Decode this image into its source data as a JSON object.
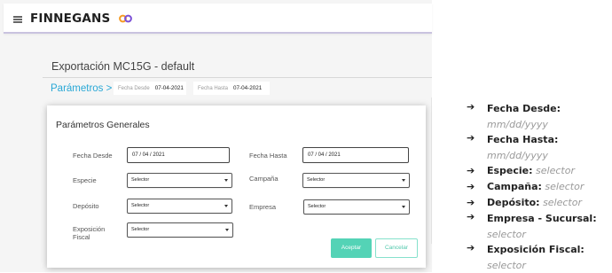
{
  "brand": {
    "name": "FINNEGANS"
  },
  "page": {
    "title": "Exportación MC15G - default"
  },
  "breadcrumb": {
    "link": "Parámetros >",
    "chips": [
      {
        "label": "Fecha Desde",
        "value": "07-04-2021"
      },
      {
        "label": "Fecha Hasta",
        "value": "07-04-2021"
      }
    ]
  },
  "dialog": {
    "title": "Parámetros Generales",
    "fields": {
      "fecha_desde": {
        "label": "Fecha Desde",
        "value": "07 / 04 / 2021"
      },
      "fecha_hasta": {
        "label": "Fecha Hasta",
        "value": "07 / 04 / 2021"
      },
      "especie": {
        "label": "Especie",
        "value": "Selector"
      },
      "campana": {
        "label": "Campaña",
        "value": "Selector"
      },
      "deposito": {
        "label": "Depósito",
        "value": "Selector"
      },
      "empresa": {
        "label": "Empresa",
        "value": "Selector"
      },
      "exposicion": {
        "label": "Exposición Fiscal",
        "value": "Selector"
      }
    },
    "buttons": {
      "accept": "Aceptar",
      "cancel": "Cancelar"
    }
  },
  "notes": [
    {
      "key": "Fecha Desde:",
      "value": "mm/dd/yyyy"
    },
    {
      "key": "Fecha Hasta:",
      "value": "mm/dd/yyyy"
    },
    {
      "key": "Especie:",
      "value": "selector"
    },
    {
      "key": "Campaña:",
      "value": "selector"
    },
    {
      "key": "Depósito:",
      "value": "selector"
    },
    {
      "key": "Empresa - Sucursal:",
      "value": "selector"
    },
    {
      "key": "Exposición Fiscal:",
      "value": "selector"
    }
  ],
  "colors": {
    "accent": "#29a8d6",
    "primary_button": "#54d3b6",
    "logo_orange": "#f59a23",
    "logo_purple": "#7b4fd6"
  },
  "icons": {
    "menu": "hamburger-icon",
    "brand": "infinity-logo-icon",
    "bullet": "arrow-right-icon",
    "dropdown": "caret-down-icon"
  }
}
